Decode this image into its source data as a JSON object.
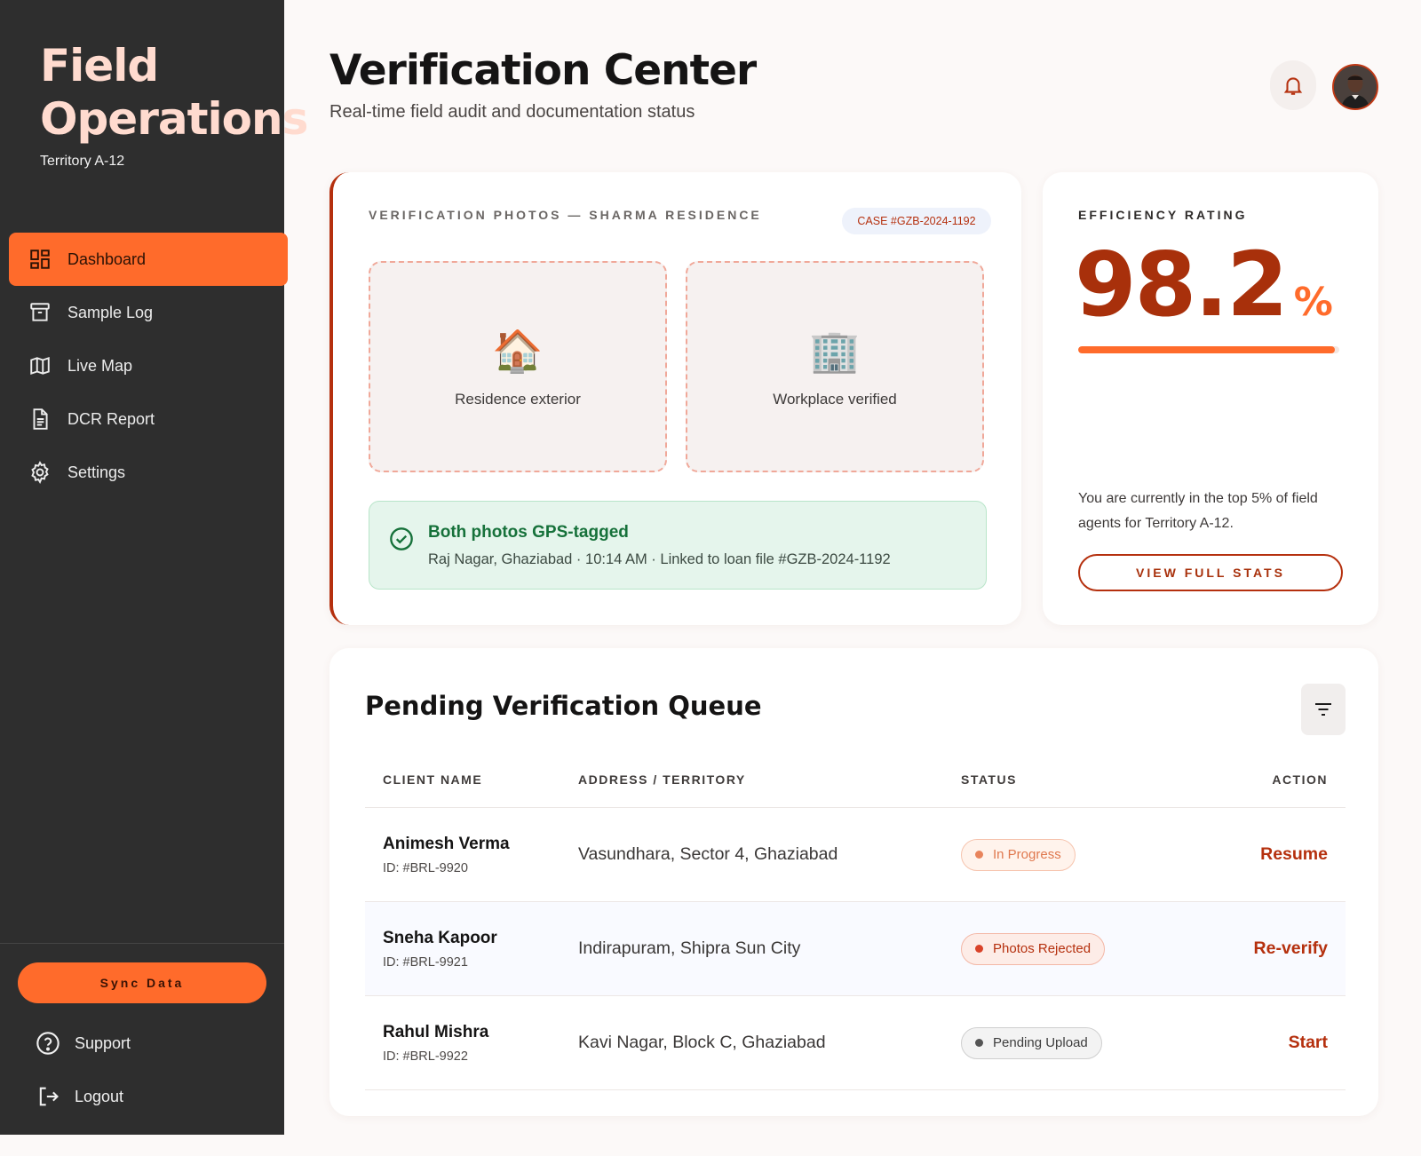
{
  "sidebar": {
    "brand_line1": "Field",
    "brand_line2": "Operations",
    "territory": "Territory A-12",
    "items": [
      {
        "label": "Dashboard",
        "icon": "dashboard-icon",
        "active": true
      },
      {
        "label": "Sample Log",
        "icon": "archive-icon",
        "active": false
      },
      {
        "label": "Live Map",
        "icon": "map-icon",
        "active": false
      },
      {
        "label": "DCR Report",
        "icon": "document-icon",
        "active": false
      },
      {
        "label": "Settings",
        "icon": "gear-icon",
        "active": false
      }
    ],
    "sync_label": "Sync Data",
    "support_label": "Support",
    "logout_label": "Logout"
  },
  "header": {
    "title": "Verification Center",
    "subtitle": "Real-time field audit and documentation status"
  },
  "photos_card": {
    "eyebrow": "VERIFICATION PHOTOS — SHARMA RESIDENCE",
    "case_chip": "CASE #GZB-2024-1192",
    "photos": [
      {
        "emoji": "🏠",
        "caption": "Residence exterior"
      },
      {
        "emoji": "🏢",
        "caption": "Workplace verified"
      }
    ],
    "gps_title": "Both photos GPS-tagged",
    "gps_detail": "Raj Nagar, Ghaziabad · 10:14 AM · Linked to loan file #GZB-2024-1192"
  },
  "efficiency": {
    "eyebrow": "EFFICIENCY RATING",
    "value": "98.2",
    "unit": "%",
    "progress": 0.982,
    "note": "You are currently in the top 5% of field agents for Territory A-12.",
    "button_label": "VIEW FULL STATS"
  },
  "queue": {
    "title": "Pending Verification Queue",
    "columns": [
      "CLIENT NAME",
      "ADDRESS / TERRITORY",
      "STATUS",
      "ACTION"
    ],
    "rows": [
      {
        "name": "Animesh Verma",
        "id": "ID: #BRL-9920",
        "address": "Vasundhara, Sector 4, Ghaziabad",
        "status": "In Progress",
        "action": "Resume"
      },
      {
        "name": "Sneha Kapoor",
        "id": "ID: #BRL-9921",
        "address": "Indirapuram, Shipra Sun City",
        "status": "Photos Rejected",
        "action": "Re-verify"
      },
      {
        "name": "Rahul Mishra",
        "id": "ID: #BRL-9922",
        "address": "Kavi Nagar, Block C, Ghaziabad",
        "status": "Pending Upload",
        "action": "Start"
      }
    ]
  },
  "colors": {
    "accent": "#ff6b2b",
    "brand_dark": "#b5300e",
    "sidebar_bg": "#2e2e2e",
    "success": "#16713a"
  }
}
